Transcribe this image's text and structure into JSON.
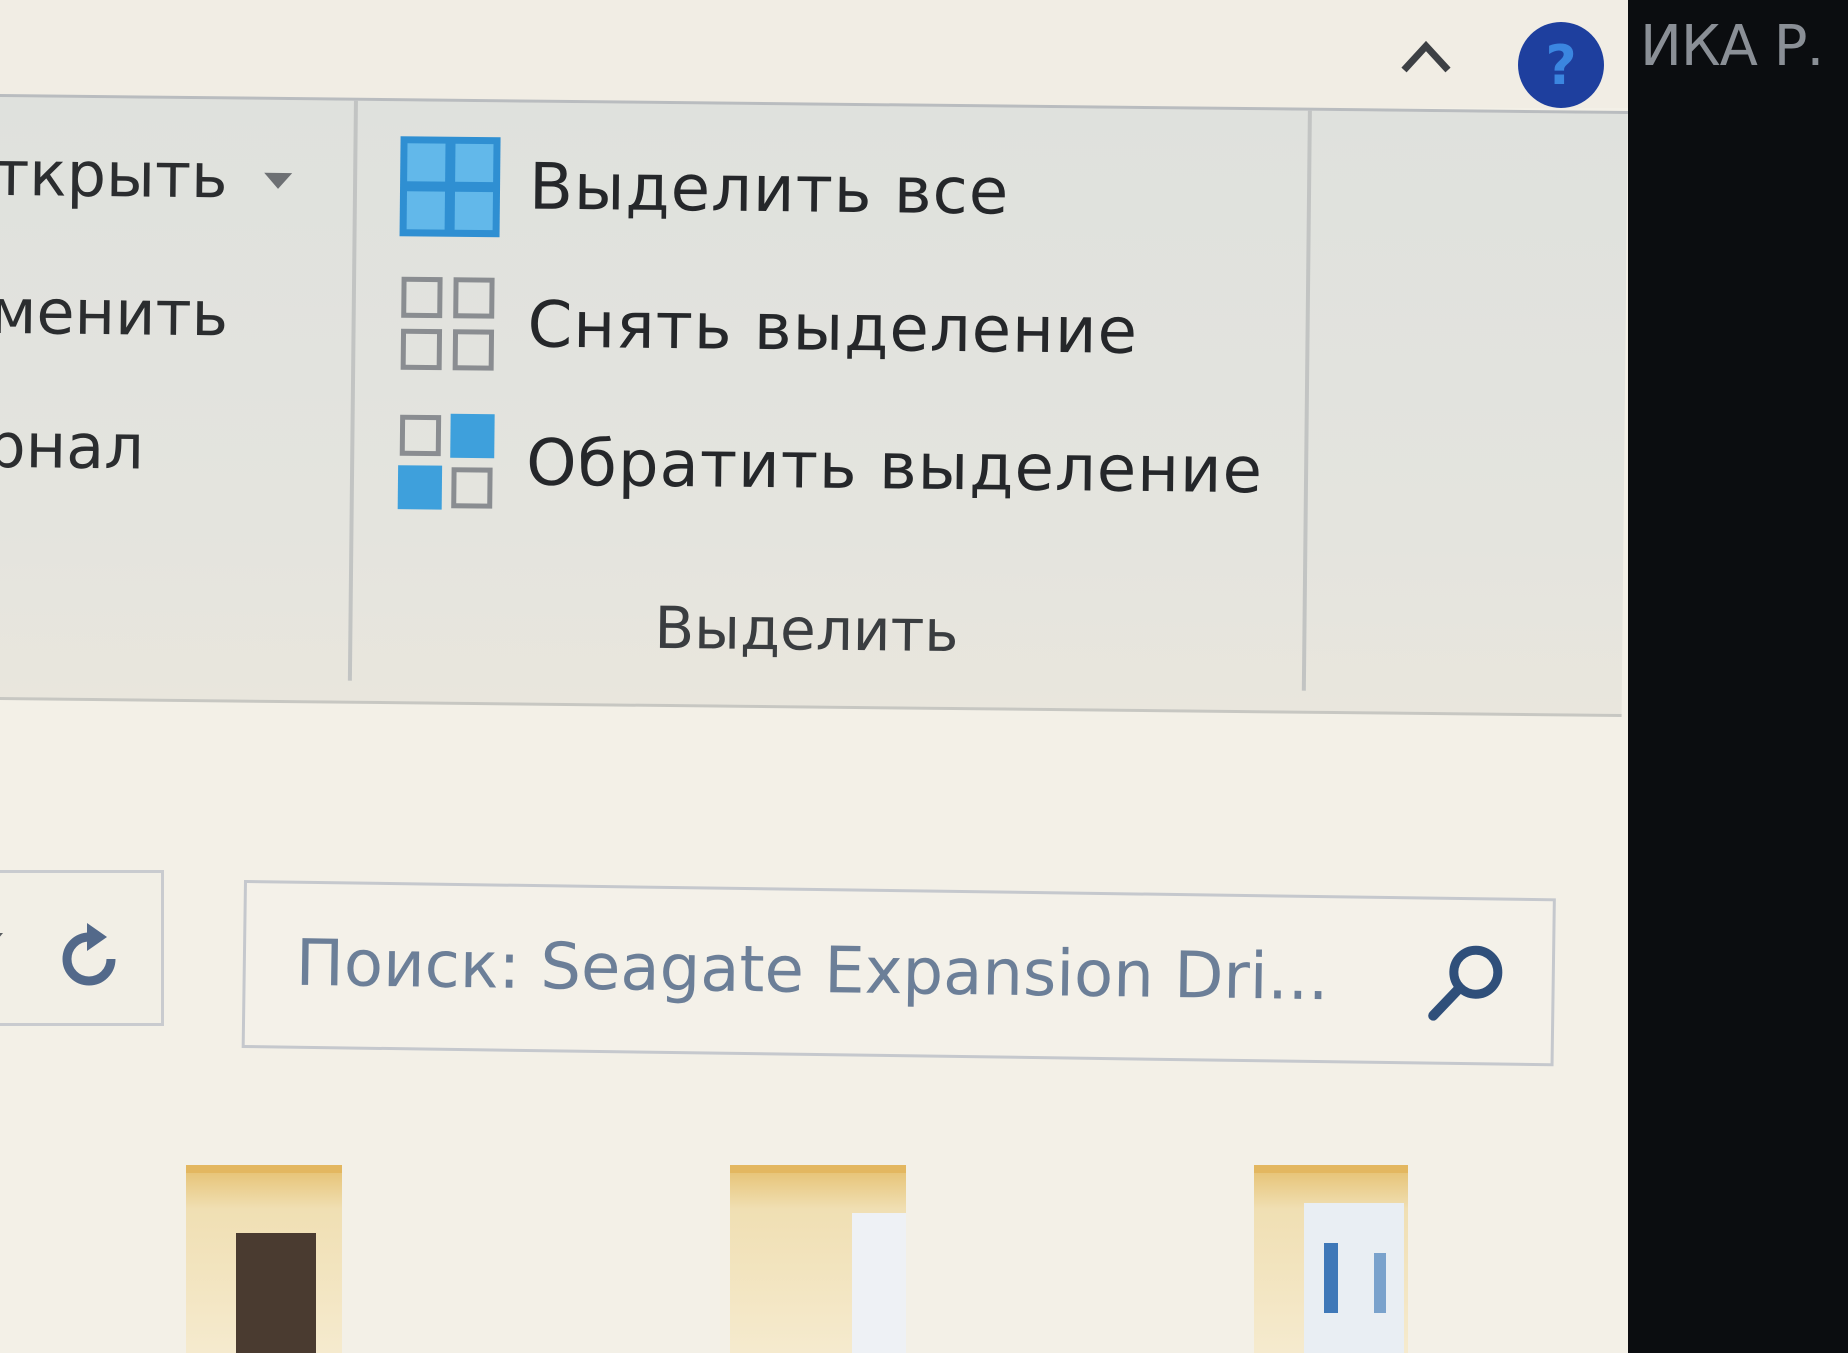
{
  "titlebar": {
    "user_label": "ИКА Р."
  },
  "ribbon": {
    "open_group": {
      "open_label": "ткрыть",
      "edit_label": "менить",
      "history_label": "рнал"
    },
    "select_group": {
      "select_all_label": "Выделить все",
      "select_none_label": "Снять выделение",
      "invert_selection_label": "Обратить выделение",
      "group_label": "Выделить"
    }
  },
  "search": {
    "placeholder": "Поиск: Seagate Expansion Dri..."
  },
  "colors": {
    "accent_blue": "#3ea0dc",
    "help_button": "#1e3f9e",
    "ribbon_bg": "#e0e1dc",
    "folder_yellow": "#e3b760"
  },
  "icons": [
    "chevron-up-icon",
    "help-icon",
    "select-all-icon",
    "select-none-icon",
    "invert-selection-icon",
    "refresh-icon",
    "search-icon",
    "dropdown-arrow-icon"
  ],
  "files": [
    {
      "name": "folder-thumbnail-1"
    },
    {
      "name": "folder-thumbnail-2"
    },
    {
      "name": "folder-thumbnail-3"
    }
  ]
}
